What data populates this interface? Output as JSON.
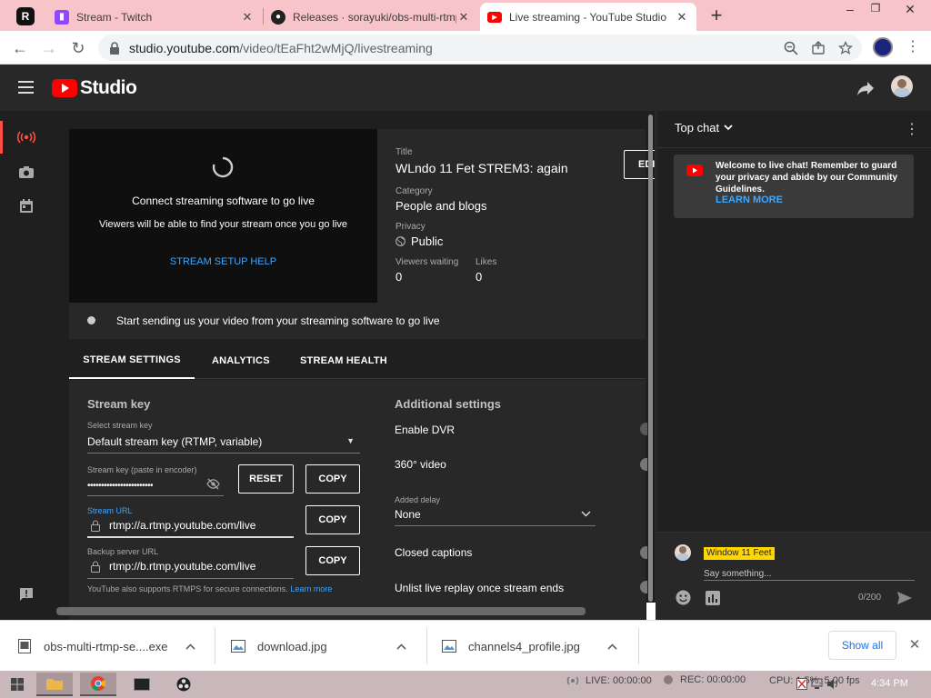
{
  "browser": {
    "tabs": [
      {
        "title": "Stream - Twitch",
        "icon": "twitch-icon"
      },
      {
        "title": "Releases · sorayuki/obs-multi-rtmp",
        "icon": "github-icon"
      },
      {
        "title": "Live streaming - YouTube Studio",
        "icon": "youtube-icon",
        "active": true
      }
    ],
    "pinned_icon": "R",
    "url_host": "studio.youtube.com",
    "url_path": "/video/tEaFht2wMjQ/livestreaming"
  },
  "studio": {
    "logo_text": "Studio"
  },
  "preview": {
    "connect": "Connect streaming software to go live",
    "viewers_note": "Viewers will be able to find your stream once you go live",
    "help_link": "STREAM SETUP HELP"
  },
  "details": {
    "title_label": "Title",
    "title": "WLndo 11 Fet STREM3: again",
    "category_label": "Category",
    "category": "People and blogs",
    "privacy_label": "Privacy",
    "privacy": "Public",
    "viewers_label": "Viewers waiting",
    "viewers": "0",
    "likes_label": "Likes",
    "likes": "0",
    "edit_button": "EDIT"
  },
  "status_bar": "Start sending us your video from your streaming software to go live",
  "tabs": [
    "STREAM SETTINGS",
    "ANALYTICS",
    "STREAM HEALTH"
  ],
  "stream_settings": {
    "heading": "Stream key",
    "select_label": "Select stream key",
    "select_value": "Default stream key (RTMP, variable)",
    "key_label": "Stream key (paste in encoder)",
    "key_value": "••••••••••••••••••••••••",
    "reset": "RESET",
    "copy": "COPY",
    "url_label": "Stream URL",
    "url_value": "rtmp://a.rtmp.youtube.com/live",
    "backup_label": "Backup server URL",
    "backup_value": "rtmp://b.rtmp.youtube.com/live",
    "rtmps_note": "YouTube also supports RTMPS for secure connections.",
    "learn_more": "Learn more"
  },
  "additional": {
    "heading": "Additional settings",
    "dvr": "Enable DVR",
    "video360": "360° video",
    "delay_label": "Added delay",
    "delay_value": "None",
    "captions": "Closed captions",
    "unlist": "Unlist live replay once stream ends"
  },
  "chat": {
    "mode": "Top chat",
    "welcome": "Welcome to live chat! Remember to guard your privacy and abide by our Community Guidelines.",
    "learn_more": "LEARN MORE",
    "author": "Window 11 Feet",
    "placeholder": "Say something...",
    "counter": "0/200"
  },
  "downloads": {
    "items": [
      "obs-multi-rtmp-se....exe",
      "download.jpg",
      "channels4_profile.jpg"
    ],
    "show_all": "Show all"
  },
  "taskbar": {
    "live": "LIVE: 00:00:00",
    "rec": "REC: 00:00:00",
    "cpu": "CPU: 1.5%, 5.00 fps",
    "time": "4:34 PM"
  },
  "colors": {
    "youtube_red": "#ff0000",
    "link_blue": "#3ea6ff",
    "tab_strip": "#f7c4c9"
  }
}
